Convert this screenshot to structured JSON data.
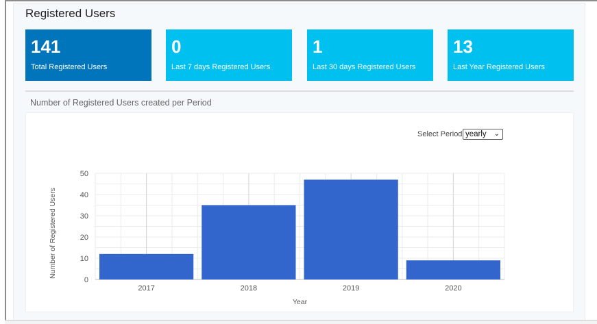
{
  "header": {
    "title": "Registered Users"
  },
  "stats": [
    {
      "number": "141",
      "label": "Total Registered Users",
      "color": "#0075bb"
    },
    {
      "number": "0",
      "label": "Last 7 days Registered Users",
      "color": "#00c0ef"
    },
    {
      "number": "1",
      "label": "Last 30 days Registered Users",
      "color": "#00c0ef"
    },
    {
      "number": "13",
      "label": "Last Year Registered Users",
      "color": "#00c0ef"
    }
  ],
  "chart_section": {
    "heading": "Number of Registered Users created per Period",
    "period_label": "Select Period:",
    "period_value": "yearly",
    "chevron_icon": "chevron-down-icon"
  },
  "chart_data": {
    "type": "bar",
    "categories": [
      "2017",
      "2018",
      "2019",
      "2020"
    ],
    "values": [
      12,
      35,
      47,
      9
    ],
    "xlabel": "Year",
    "ylabel": "Number of Registered Users",
    "ylim": [
      0,
      50
    ],
    "yticks": [
      0,
      10,
      20,
      30,
      40,
      50
    ],
    "grid": true,
    "bar_color": "#3366cc"
  }
}
